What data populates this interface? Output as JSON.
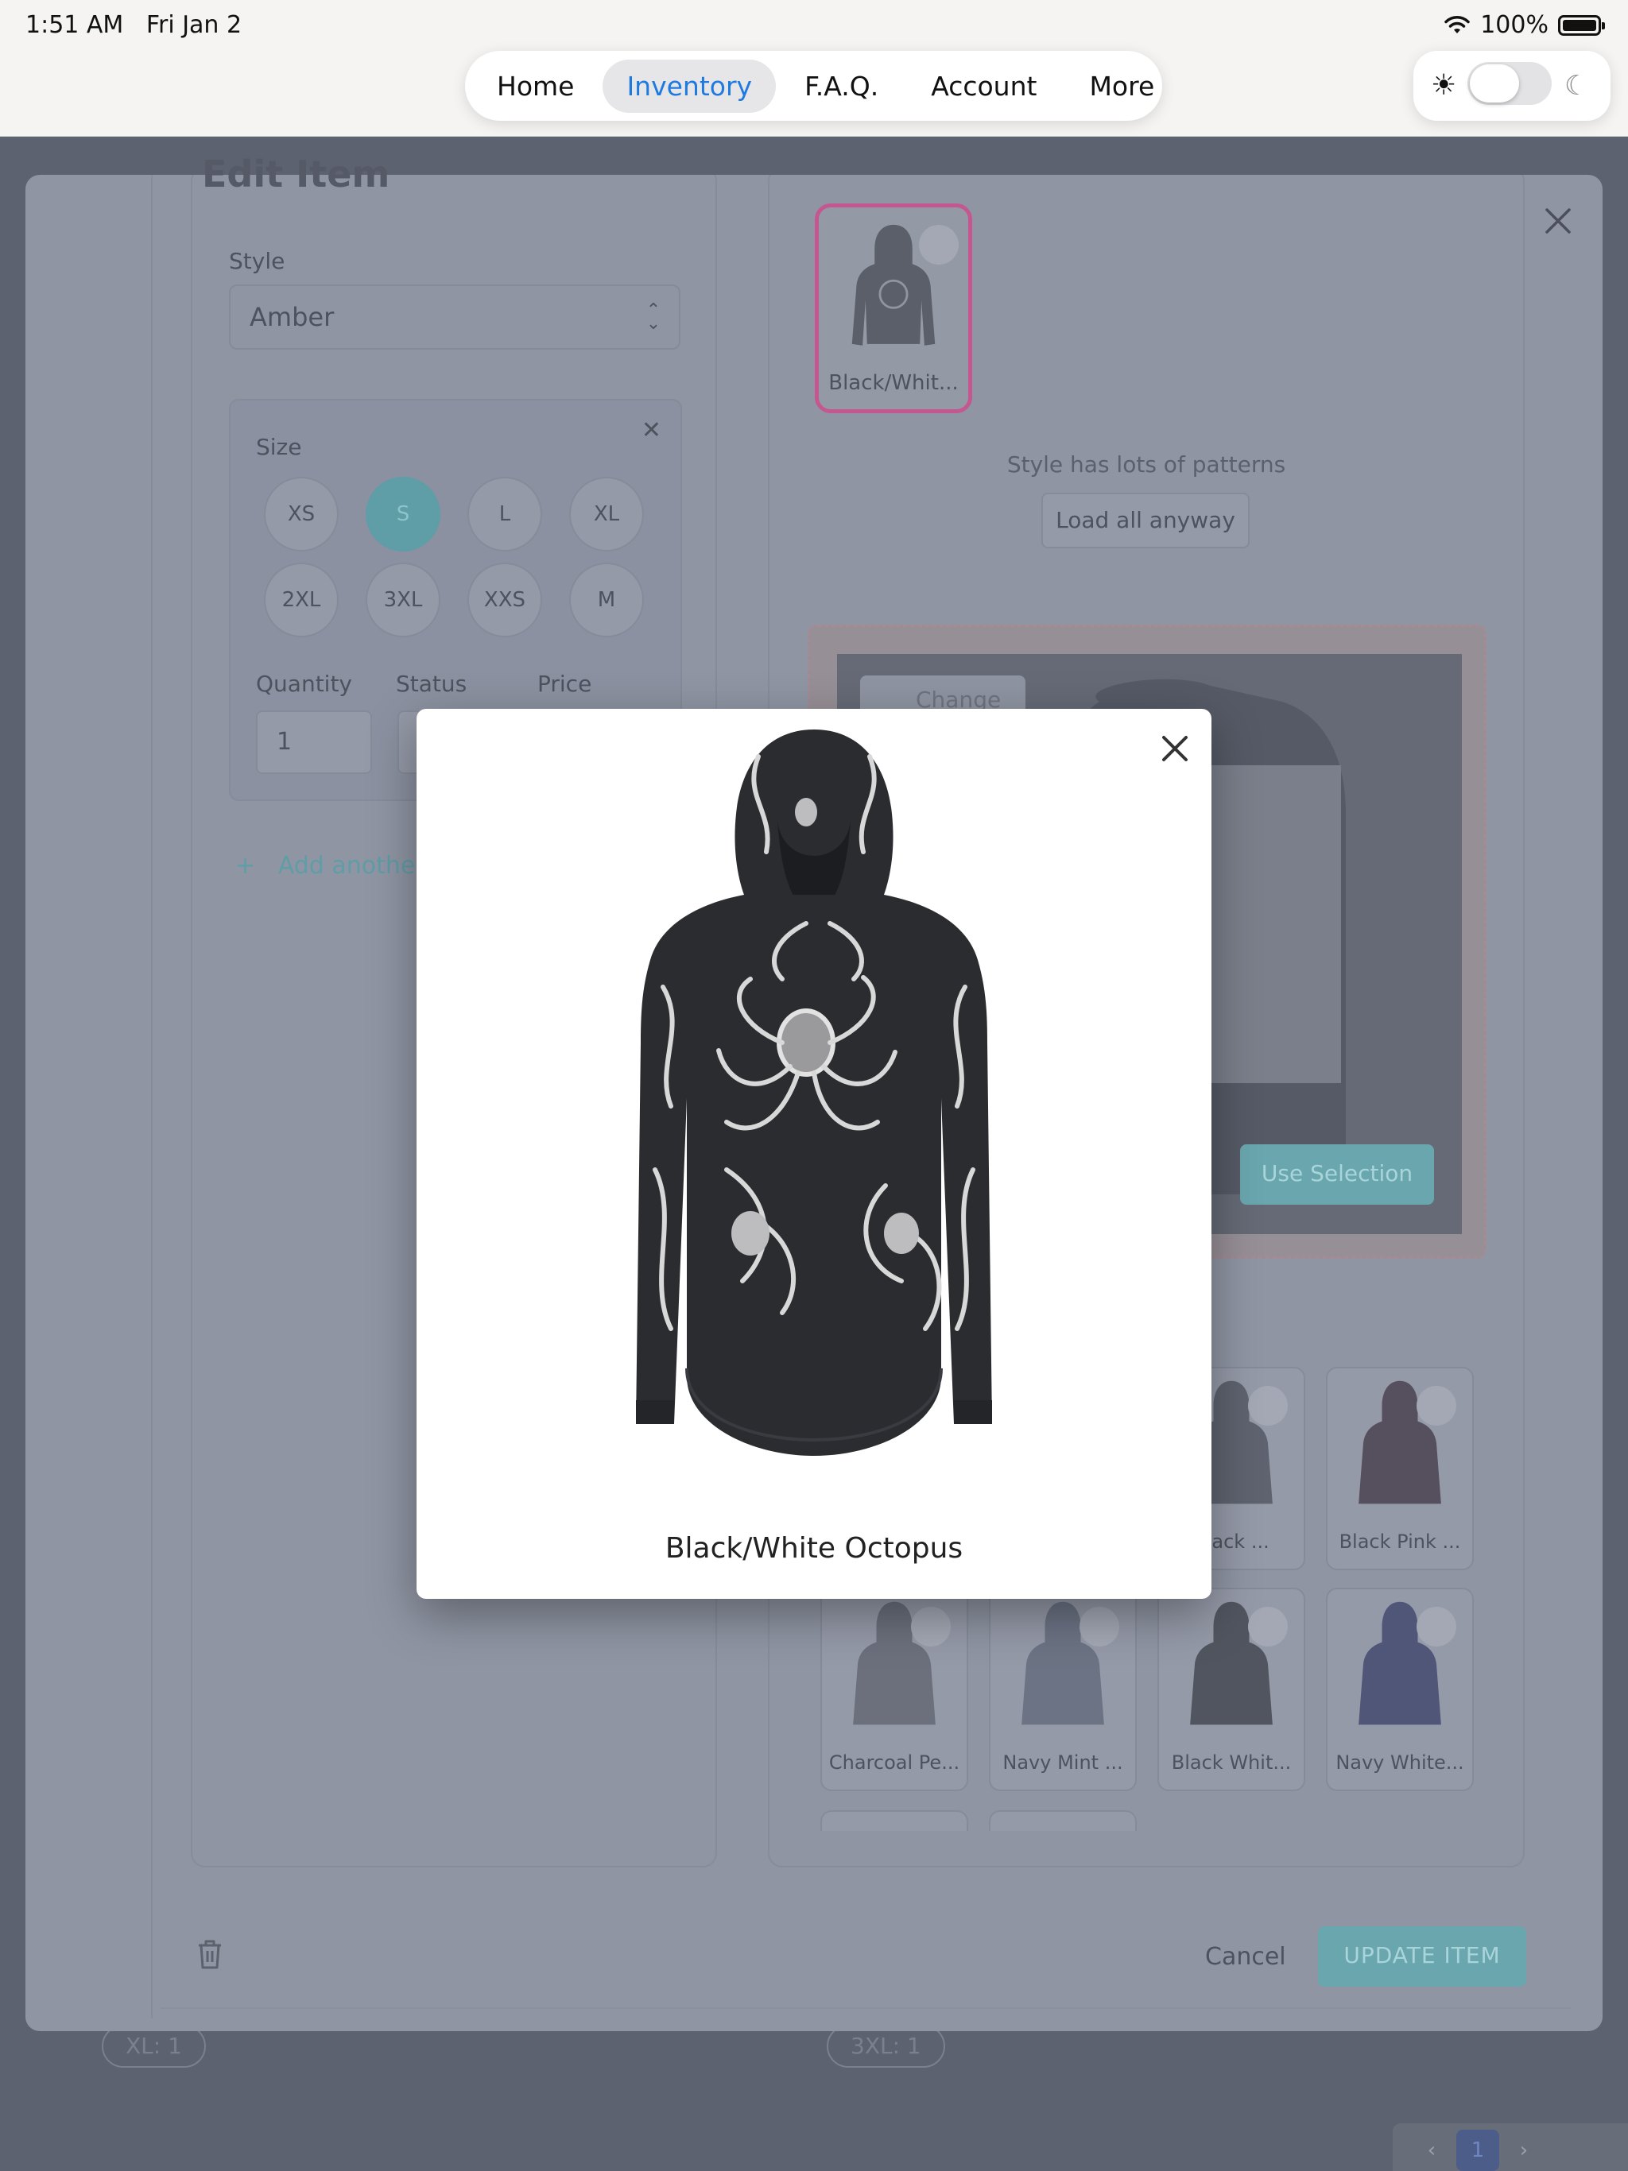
{
  "status_bar": {
    "time": "1:51 AM",
    "date": "Fri Jan 2",
    "battery": "100%"
  },
  "nav": {
    "items": [
      "Home",
      "Inventory",
      "F.A.Q.",
      "Account",
      "More"
    ],
    "active": "Inventory",
    "accent_color": "#1f7ae0"
  },
  "theme_toggle": {
    "sun_icon": "sun-icon",
    "moon_icon": "moon-icon",
    "dark_mode": false
  },
  "edit_item": {
    "title": "Edit Item",
    "style_label": "Style",
    "style_value": "Amber",
    "size_card": {
      "label": "Size",
      "sizes": [
        "XS",
        "S",
        "L",
        "XL",
        "2XL",
        "3XL",
        "XXS",
        "M"
      ],
      "selected": "S",
      "quantity_label": "Quantity",
      "status_label": "Status",
      "price_label": "Price",
      "quantity_value": "1"
    },
    "add_another_label": "Add another s",
    "selected_pattern_label": "Black/Whit...",
    "patterns_note": "Style has lots of patterns",
    "load_all_label": "Load all anyway",
    "change_label": "Change",
    "use_selection_label": "Use Selection",
    "pattern_cards": [
      {
        "label": "Black ..."
      },
      {
        "label": "Black Pink ..."
      },
      {
        "label": "Charcoal Pe..."
      },
      {
        "label": "Navy Mint ..."
      },
      {
        "label": "Black Whit..."
      },
      {
        "label": "Navy White..."
      }
    ],
    "cancel_label": "Cancel",
    "update_label": "UPDATE ITEM",
    "accent_color": "#5f9da7",
    "highlight_color": "#c4578f"
  },
  "background_chips": [
    "XL: 1",
    "3XL: 1"
  ],
  "pager": {
    "current_page": "1"
  },
  "preview": {
    "caption": "Black/White Octopus",
    "image_description_icon": "hoodie-image"
  }
}
